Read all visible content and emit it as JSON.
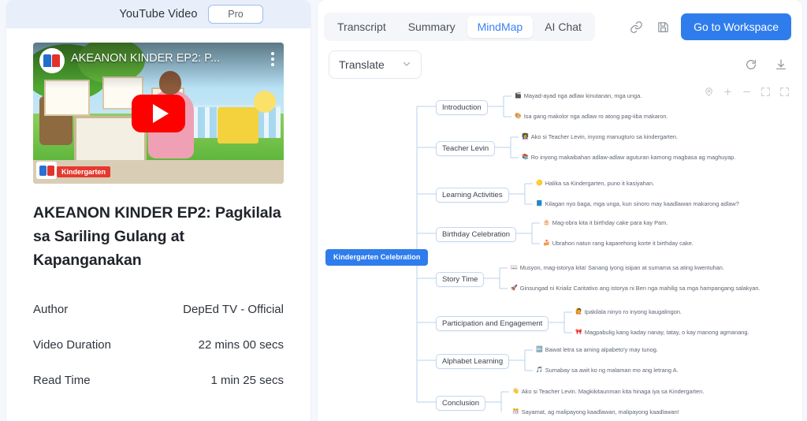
{
  "left": {
    "header_title": "YouTube Video",
    "pro_label": "Pro",
    "video": {
      "overlay_title": "AKEANON KINDER EP2: P...",
      "badge": "Kindergarten",
      "play_icon": "play-icon",
      "kebab_icon": "more-vertical-icon",
      "channel_avatar": "deped-tv-avatar"
    },
    "title": "AKEANON KINDER EP2: Pagkilala sa Sariling Gulang at Kapanganakan",
    "meta": [
      {
        "label": "Author",
        "value": "DepEd TV - Official"
      },
      {
        "label": "Video Duration",
        "value": "22 mins 00 secs"
      },
      {
        "label": "Read Time",
        "value": "1 min 25 secs"
      }
    ]
  },
  "right": {
    "tabs": [
      {
        "label": "Transcript",
        "active": false
      },
      {
        "label": "Summary",
        "active": false
      },
      {
        "label": "MindMap",
        "active": true
      },
      {
        "label": "AI Chat",
        "active": false
      }
    ],
    "link_icon": "link-icon",
    "save_icon": "save-floppy-icon",
    "workspace_button": "Go to Workspace",
    "translate_label": "Translate",
    "translate_chevron": "chevron-down-icon",
    "refresh_icon": "refresh-icon",
    "download_icon": "download-icon",
    "map_controls": [
      "locate-pin-icon",
      "zoom-in-icon",
      "zoom-out-icon",
      "fit-screen-icon",
      "fullscreen-icon"
    ],
    "accent_color": "#2f7ded",
    "node_border_color": "#c3d7f2"
  },
  "mindmap": {
    "root": "Kindergarten Celebration",
    "branches": [
      {
        "label": "Introduction",
        "leaves": [
          {
            "emoji": "🎬",
            "text": "Mayad-ayad nga adlaw kinutanan, mga unga."
          },
          {
            "emoji": "🎨",
            "text": "Isa gang makolor nga adlaw ro atong pag-iiba makaron."
          }
        ]
      },
      {
        "label": "Teacher Levin",
        "leaves": [
          {
            "emoji": "👩‍🏫",
            "text": "Ako si Teacher Levin, inyong manugturo sa kindergarten."
          },
          {
            "emoji": "📚",
            "text": "Ro inyong makaibahan adlaw-adlaw aguturan kamong magbasa ag maghuyap."
          }
        ]
      },
      {
        "label": "Learning Activities",
        "leaves": [
          {
            "emoji": "🟡",
            "text": "Halika sa Kindergarten, puno it kasiyahan."
          },
          {
            "emoji": "📘",
            "text": "Kilagan nyo baga, mga unga, kun sinoro may kaadlawan makarong adlaw?"
          }
        ]
      },
      {
        "label": "Birthday Celebration",
        "leaves": [
          {
            "emoji": "🎂",
            "text": "Mag-obra kita it birthday cake para kay Pam."
          },
          {
            "emoji": "🍰",
            "text": "Ubrahon natun rang kaparehong korte it birthday cake."
          }
        ]
      },
      {
        "label": "Story Time",
        "leaves": [
          {
            "emoji": "📖",
            "text": "Musyon, mag-istorya kita! Sanang iyong isipan at sumama sa ating kwentuhan."
          },
          {
            "emoji": "🚀",
            "text": "Ginsungad ni Krializ Caritativo ang istorya ni Ben nga mahilig sa mga hampangang salakyan."
          }
        ]
      },
      {
        "label": "Participation and Engagement",
        "leaves": [
          {
            "emoji": "🙋",
            "text": "Ipakilala ninyo ro inyong kaugalingon."
          },
          {
            "emoji": "🎀",
            "text": "Magpabulig kang kaday nanay, tatay, o kay manong agmanang."
          }
        ]
      },
      {
        "label": "Alphabet Learning",
        "leaves": [
          {
            "emoji": "🔤",
            "text": "Bawat letra sa aming alpabeto'y may tunog."
          },
          {
            "emoji": "🎵",
            "text": "Sumabay sa awit ko ng malaman mo ang letrang A."
          }
        ]
      },
      {
        "label": "Conclusion",
        "leaves": [
          {
            "emoji": "👋",
            "text": "Ako si Teacher Levin. Magkikitaunman kita hinaga iya sa Kindergarten."
          },
          {
            "emoji": "🎊",
            "text": "Sayamat, ag malipayong kaadlawan, malipayong kaadlawan!"
          }
        ]
      }
    ]
  }
}
